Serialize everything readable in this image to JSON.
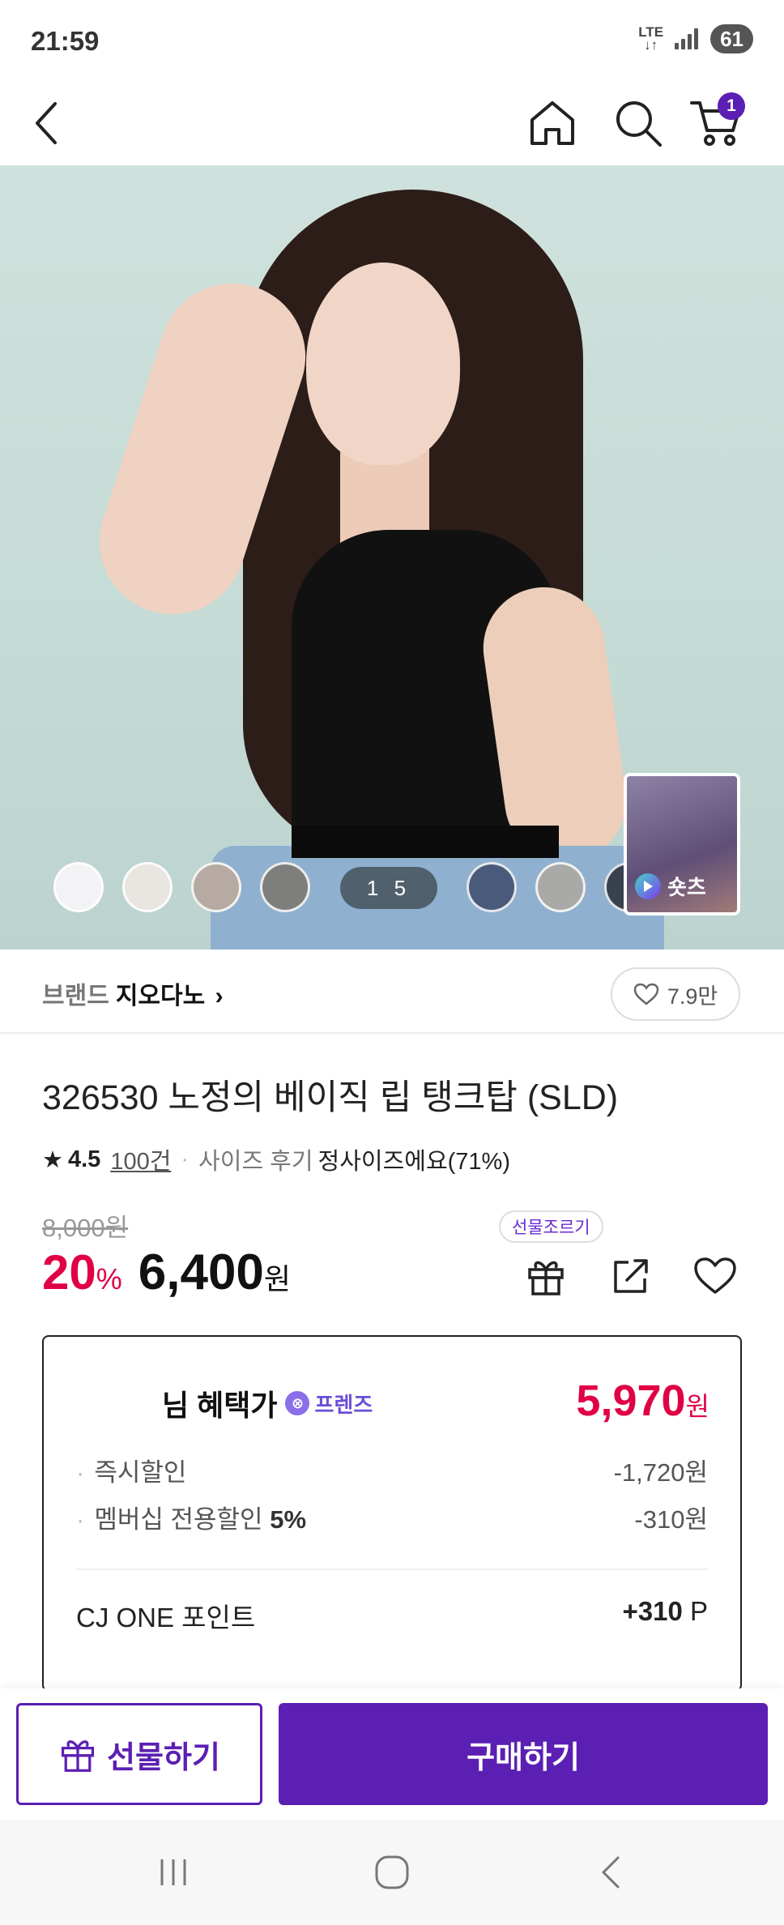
{
  "status_bar": {
    "time": "21:59",
    "network": "LTE",
    "battery": "61"
  },
  "nav": {
    "cart_count": "1"
  },
  "hero": {
    "counter": "1 5",
    "shorts_label": "숏츠",
    "swatch_colors": [
      "#f3f3f5",
      "#e9e5e0",
      "#b6aaa2",
      "#7e7f7c",
      "#3a3e4a",
      "#2b2f3a",
      "#4a5a7a",
      "#a9aaa8",
      "#39404e"
    ]
  },
  "brand": {
    "label": "브랜드",
    "name": "지오다노",
    "likes": "7.9만"
  },
  "product": {
    "title": "326530 노정의 베이직 립 탱크탑 (SLD)",
    "rating": "4.5",
    "review_count": "100건",
    "size_review_label": "사이즈 후기",
    "size_review_value": "정사이즈에요(71%)",
    "original_price": "8,000원",
    "discount": "20",
    "discount_unit": "%",
    "sale_price": "6,400",
    "sale_unit": "원",
    "gift_tooltip": "선물조르기"
  },
  "benefit": {
    "title": "님 혜택가",
    "badge": "프렌즈",
    "price": "5,970",
    "price_unit": "원",
    "lines": [
      {
        "label": "즉시할인",
        "bold": "",
        "value": "-1,720원"
      },
      {
        "label": "멤버십 전용할인",
        "bold": "5%",
        "value": "-310원"
      }
    ],
    "cj_label": "CJ ONE 포인트",
    "cj_value": "+310",
    "cj_unit": "P"
  },
  "actions": {
    "gift_label": "선물하기",
    "buy_label": "구매하기"
  },
  "colors": {
    "accent": "#5b1fb3",
    "sale": "#e00045"
  }
}
